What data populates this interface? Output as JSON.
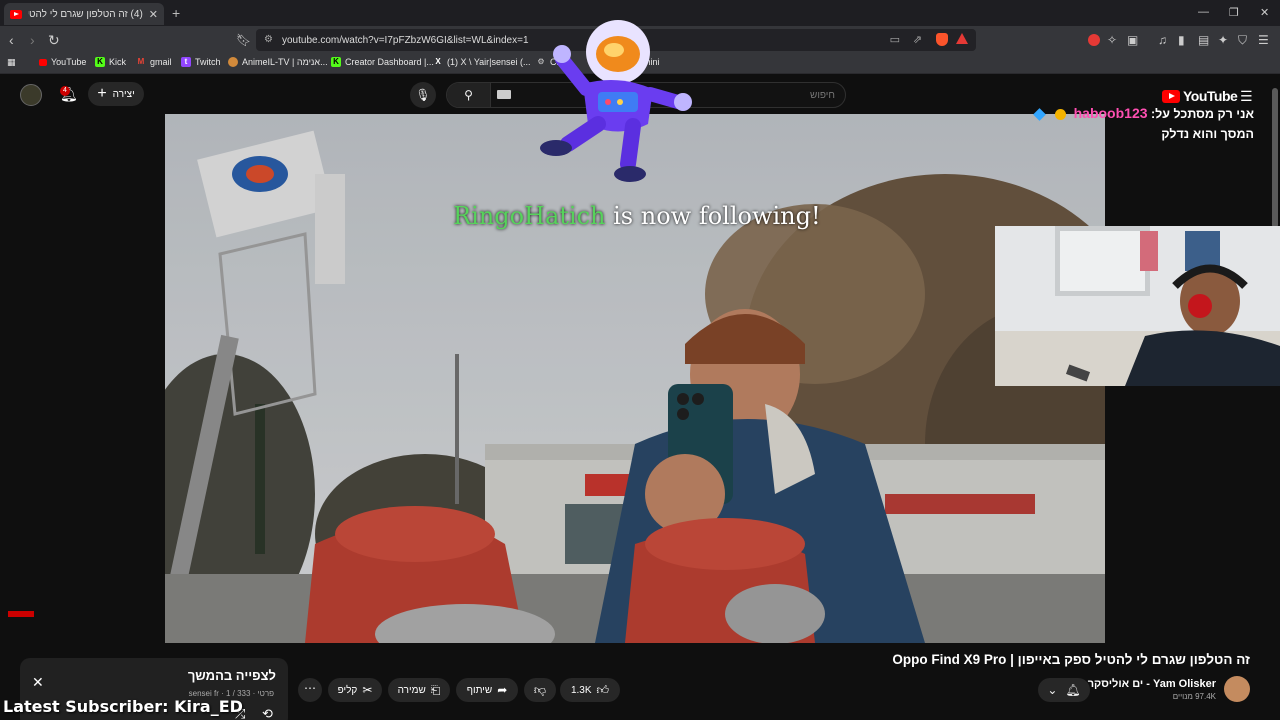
{
  "browser": {
    "tab_title": "(4) זה הטלפון שגרם לי להטיל ספ",
    "tab_close": "✕",
    "new_tab": "+",
    "url": "youtube.com/watch?v=I7pFZbzW6GI&list=WL&index=1",
    "window_controls": [
      "—",
      "❐",
      "✕"
    ]
  },
  "bookmarks": [
    {
      "label": "YouTube",
      "icon": "youtube-icon",
      "color": "#ff0000"
    },
    {
      "label": "Kick",
      "icon": "kick-icon",
      "color": "#53fc18"
    },
    {
      "label": "gmail",
      "icon": "gmail-icon",
      "color": "#ea4335"
    },
    {
      "label": "Twitch",
      "icon": "twitch-icon",
      "color": "#9146ff"
    },
    {
      "label": "AnimeIL-TV | אנימה...",
      "icon": "animeil-icon",
      "color": "#d28a3b"
    },
    {
      "label": "Creator Dashboard |...",
      "icon": "kick-icon",
      "color": "#53fc18"
    },
    {
      "label": "(1) X \\ Yair|sensei (...",
      "icon": "x-icon",
      "color": "#ffffff"
    },
    {
      "label": "Ch",
      "icon": "chatgpt-icon",
      "color": "#cccccc"
    },
    {
      "label": "mini",
      "icon": "gemini-icon",
      "color": "#8ab4f8"
    }
  ],
  "youtube": {
    "create_label": "יצירה",
    "notif_count": "4",
    "search_placeholder": "חיפוש",
    "logo_text": "YouTube",
    "video": {
      "title": "זה הטלפון שגרם לי להטיל ספק באייפון | Oppo Find X9 Pro",
      "channel": "Yam Olisker - ים אוליסקר",
      "subscribers": "97.4K מנויים",
      "likes": "1.3K",
      "share_label": "שיתוף",
      "save_label": "שמירה",
      "clip_label": "קליפ",
      "more_label": "⋯"
    },
    "playlist": {
      "title": "לצפייה בהמשך",
      "meta": "פרטי · sensei fr · 1 / 333"
    }
  },
  "stream_overlay": {
    "chat_user": "haboob123",
    "chat_message_1": "אני רק מסתכל על:",
    "chat_message_2": "המסך והוא נדלק",
    "follow_name": "RingoHatich",
    "follow_text": " is now following!",
    "latest_subscriber": "Latest Subscriber: Kira_ED"
  },
  "colors": {
    "accent": "#ff0000",
    "follow_name": "#56d35b",
    "chat_user": "#ff4fb2"
  }
}
